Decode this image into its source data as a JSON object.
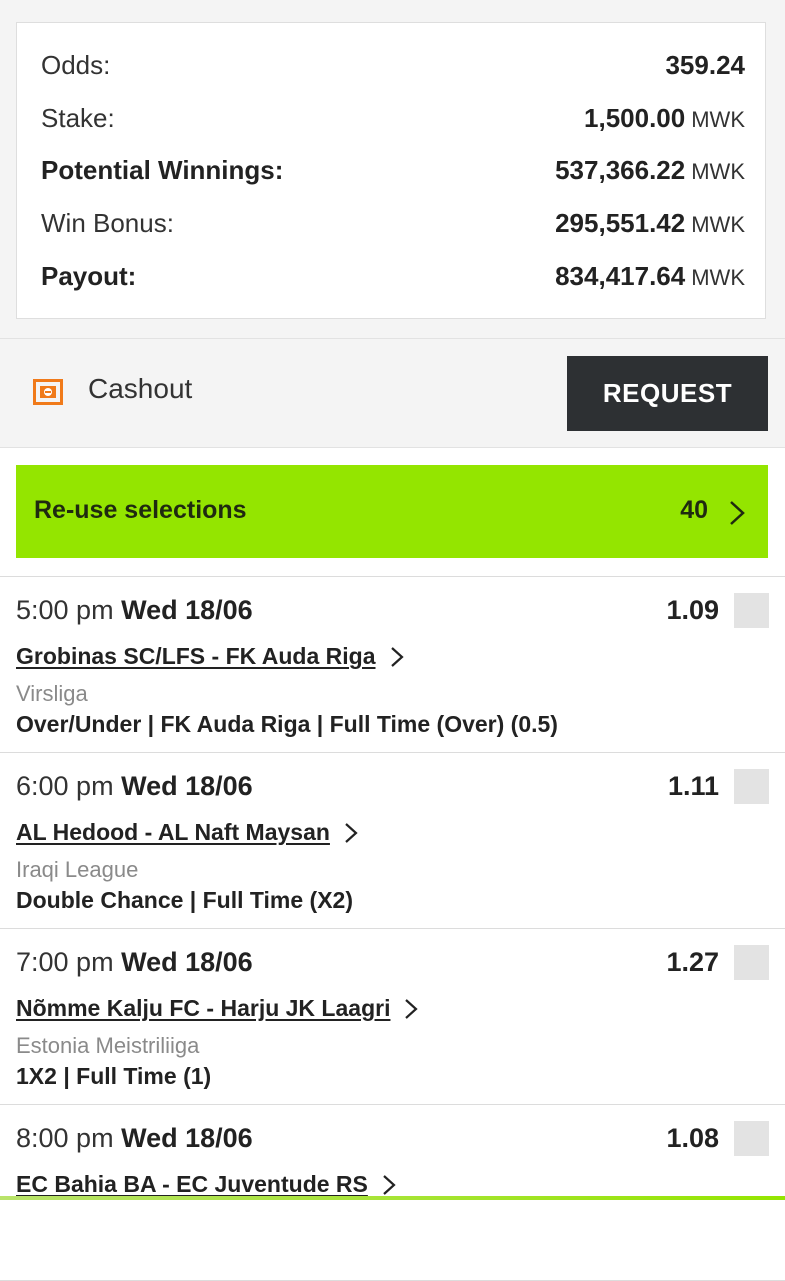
{
  "summary": {
    "rows": [
      {
        "label": "Odds:",
        "value": "359.24",
        "currency": "",
        "bold_label": false
      },
      {
        "label": "Stake:",
        "value": "1,500.00",
        "currency": "MWK",
        "bold_label": false
      },
      {
        "label": "Potential Winnings:",
        "value": "537,366.22",
        "currency": "MWK",
        "bold_label": true
      },
      {
        "label": "Win Bonus:",
        "value": "295,551.42",
        "currency": "MWK",
        "bold_label": false
      },
      {
        "label": "Payout:",
        "value": "834,417.64",
        "currency": "MWK",
        "bold_label": true
      }
    ]
  },
  "cashout": {
    "label": "Cashout",
    "icon": "cashout-icon",
    "button_label": "REQUEST",
    "accent": "#f07a1a"
  },
  "reuse": {
    "label": "Re-use selections",
    "count": "40",
    "color": "#94e500"
  },
  "selections": [
    {
      "time": "5:00 pm",
      "date": "Wed 18/06",
      "odds": "1.09",
      "match": "Grobinas SC/LFS - FK Auda Riga",
      "league": "Virsliga",
      "market": "Over/Under | FK Auda Riga | Full Time (Over) (0.5)"
    },
    {
      "time": "6:00 pm",
      "date": "Wed 18/06",
      "odds": "1.11",
      "match": "AL Hedood - AL Naft Maysan",
      "league": "Iraqi League",
      "market": "Double Chance | Full Time (X2)"
    },
    {
      "time": "7:00 pm",
      "date": "Wed 18/06",
      "odds": "1.27",
      "match": "Nõmme Kalju FC - Harju JK Laagri",
      "league": "Estonia Meistriliiga",
      "market": "1X2 | Full Time (1)"
    },
    {
      "time": "8:00 pm",
      "date": "Wed 18/06",
      "odds": "1.08",
      "match": "EC Bahia BA - EC Juventude RS",
      "league": "",
      "market": ""
    }
  ]
}
